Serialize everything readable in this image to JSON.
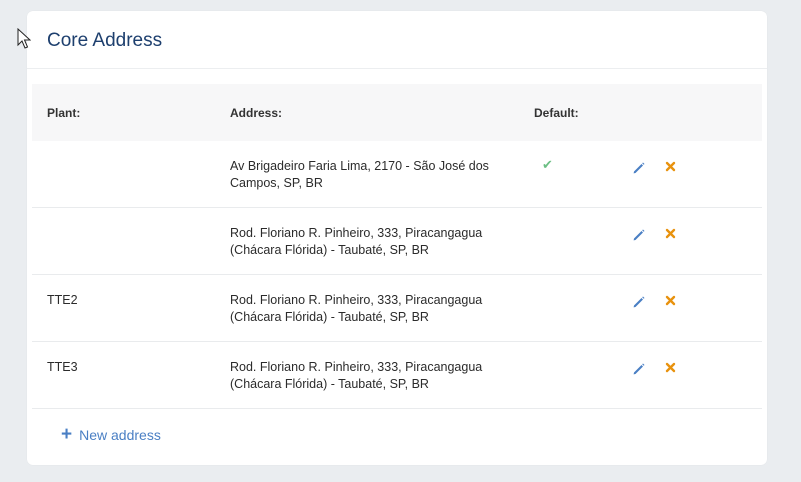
{
  "card": {
    "title": "Core Address"
  },
  "table": {
    "headers": {
      "plant": "Plant:",
      "address": "Address:",
      "default": "Default:"
    },
    "rows": [
      {
        "plant": "",
        "address_line1": "Av Brigadeiro Faria Lima, 2170 - São José dos",
        "address_line2": "Campos, SP, BR",
        "default_mark": "✔"
      },
      {
        "plant": "",
        "address_line1": "Rod. Floriano R. Pinheiro, 333, Piracangagua",
        "address_line2": "(Chácara Flórida) - Taubaté, SP, BR",
        "default_mark": ""
      },
      {
        "plant": "TTE2",
        "address_line1": "Rod. Floriano R. Pinheiro, 333, Piracangagua",
        "address_line2": "(Chácara Flórida) - Taubaté, SP, BR",
        "default_mark": ""
      },
      {
        "plant": "TTE3",
        "address_line1": "Rod. Floriano R. Pinheiro, 333, Piracangagua",
        "address_line2": "(Chácara Flórida) - Taubaté, SP, BR",
        "default_mark": ""
      }
    ],
    "row_icons": {
      "edit": "pencil-icon",
      "delete": "x-icon"
    }
  },
  "actions": {
    "new_address_label": "New address",
    "new_address_icon": "plus-icon"
  },
  "colors": {
    "title": "#1d3f6e",
    "link": "#4a7fc4",
    "default_check": "#6cbf84",
    "edit_icon": "#4a7fc4",
    "delete_icon": "#e8920e"
  }
}
